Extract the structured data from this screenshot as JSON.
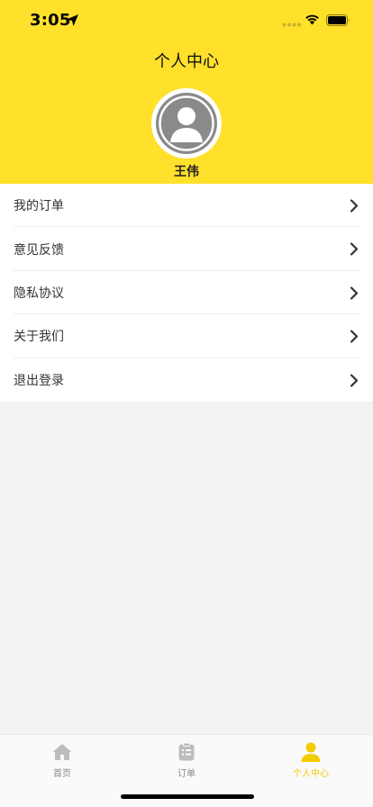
{
  "status_bar": {
    "time": "3:05"
  },
  "header": {
    "title": "个人中心",
    "user_name": "王伟"
  },
  "menu": {
    "items": [
      {
        "label": "我的订单"
      },
      {
        "label": "意见反馈"
      },
      {
        "label": "隐私协议"
      },
      {
        "label": "关于我们"
      },
      {
        "label": "退出登录"
      }
    ]
  },
  "tabbar": {
    "tabs": [
      {
        "label": "首页",
        "icon": "home-icon"
      },
      {
        "label": "订单",
        "icon": "order-icon"
      },
      {
        "label": "个人中心",
        "icon": "user-icon",
        "active": true
      }
    ]
  },
  "colors": {
    "brand_yellow": "#ffe02b",
    "active_tab": "#f3cc00",
    "inactive_tab": "#888888",
    "page_background": "#f3f3f3"
  }
}
